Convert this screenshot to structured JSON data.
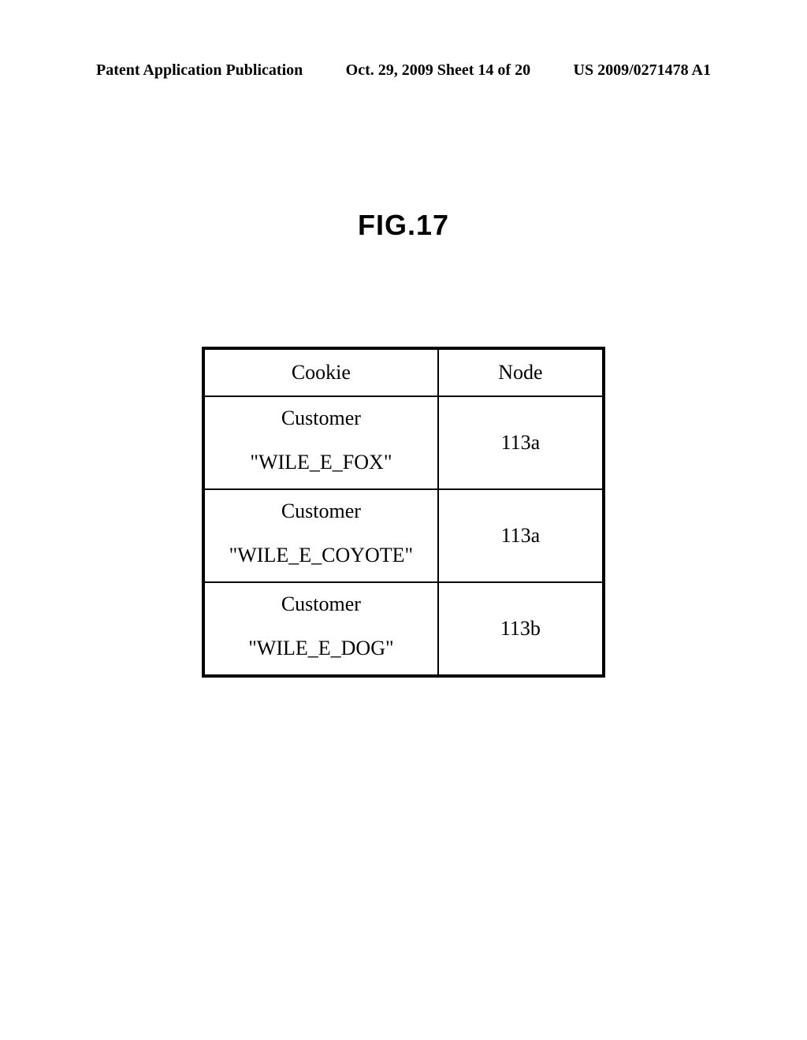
{
  "header": {
    "left": "Patent Application Publication",
    "center": "Oct. 29, 2009  Sheet 14 of 20",
    "right": "US 2009/0271478 A1"
  },
  "figure": {
    "label": "FIG.17"
  },
  "table": {
    "headers": {
      "cookie": "Cookie",
      "node": "Node"
    },
    "customer_label": "Customer",
    "rows": [
      {
        "cookie_value": "\"WILE_E_FOX\"",
        "node": "113a"
      },
      {
        "cookie_value": "\"WILE_E_COYOTE\"",
        "node": "113a"
      },
      {
        "cookie_value": "\"WILE_E_DOG\"",
        "node": "113b"
      }
    ]
  }
}
